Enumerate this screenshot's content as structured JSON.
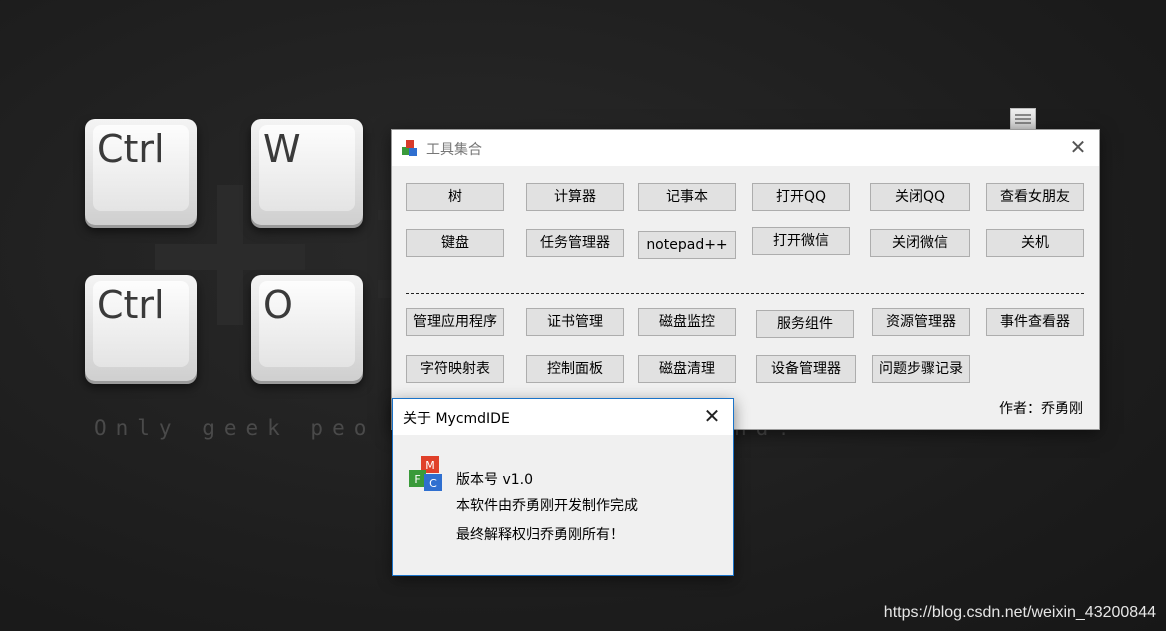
{
  "wallpaper": {
    "keys": [
      "Ctrl",
      "W",
      "Ctrl",
      "O"
    ],
    "slogan": "Only geek peo",
    "slogan_tail": "nd!"
  },
  "main_window": {
    "title": "工具集合",
    "author": "作者：乔勇刚",
    "row1": [
      "树",
      "计算器",
      "记事本",
      "打开QQ",
      "关闭QQ",
      "查看女朋友"
    ],
    "row2": [
      "键盘",
      "任务管理器",
      "notepad++",
      "打开微信",
      "关闭微信",
      "关机"
    ],
    "row3": [
      "管理应用程序",
      "证书管理",
      "磁盘监控",
      "服务组件",
      "资源管理器",
      "事件查看器"
    ],
    "row4": [
      "字符映射表",
      "控制面板",
      "磁盘清理",
      "设备管理器",
      "问题步骤记录"
    ]
  },
  "about_dialog": {
    "title": "关于 MycmdIDE",
    "version": "版本号 v1.0",
    "line2": "本软件由乔勇刚开发制作完成",
    "line3": "最终解释权归乔勇刚所有！"
  },
  "watermark": "https://blog.csdn.net/weixin_43200844"
}
